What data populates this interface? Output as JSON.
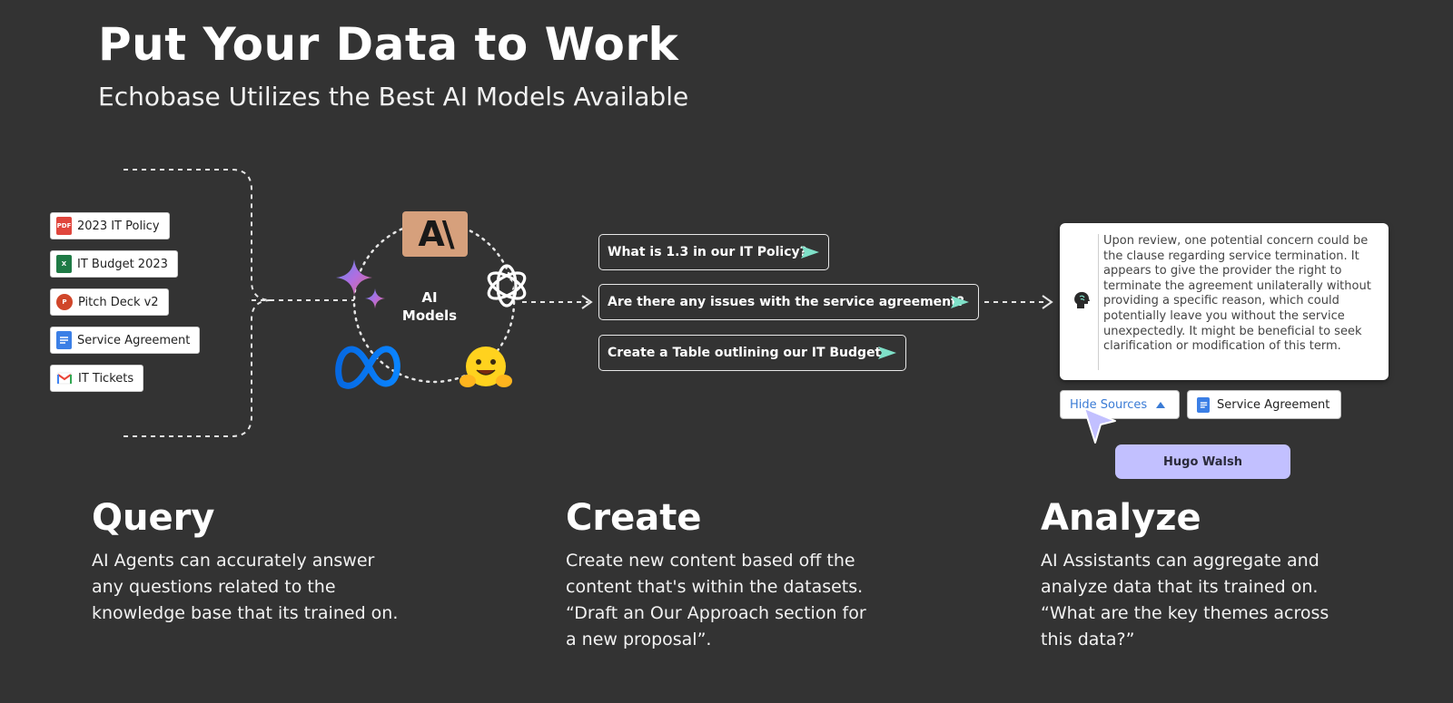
{
  "header": {
    "title": "Put Your Data to Work",
    "subtitle": "Echobase Utilizes the Best AI Models Available"
  },
  "files": [
    {
      "label": "2023 IT Policy",
      "icon": "pdf-icon",
      "icon_text": "PDF",
      "color": "#e0463d"
    },
    {
      "label": "IT Budget 2023",
      "icon": "excel-icon",
      "icon_text": "X",
      "color": "#1e7a45"
    },
    {
      "label": "Pitch Deck v2",
      "icon": "powerpoint-icon",
      "icon_text": "P",
      "color": "#d0462a"
    },
    {
      "label": "Service Agreement",
      "icon": "docs-icon",
      "icon_text": "",
      "color": "#3b7fe6"
    },
    {
      "label": "IT Tickets",
      "icon": "gmail-icon",
      "icon_text": "M",
      "color": "#ea4335"
    }
  ],
  "models": {
    "label_line1": "AI",
    "label_line2": "Models",
    "anthropic_text": "A\\",
    "icons": [
      "anthropic-icon",
      "openai-icon",
      "gemini-icon",
      "meta-icon",
      "huggingface-icon"
    ]
  },
  "queries": [
    {
      "label": "What is 1.3 in our IT Policy?"
    },
    {
      "label": "Are there any issues with the service agreement?"
    },
    {
      "label": "Create a Table outlining our IT Budget"
    }
  ],
  "answer": {
    "text": "Upon review, one potential concern could be the clause regarding service termination. It appears to give the provider the right to terminate the agreement unilaterally without providing a specific reason, which could potentially leave you without the service unexpectedly. It might be beneficial to seek clarification or modification of this term."
  },
  "sources": {
    "toggle_label": "Hide Sources",
    "doc_label": "Service Agreement"
  },
  "cursor_user": "Hugo Walsh",
  "columns": [
    {
      "heading": "Query",
      "body": "AI Agents can accurately answer any questions related to the knowledge base that its trained on."
    },
    {
      "heading": "Create",
      "body": "Create new content based off the content that's within the datasets. “Draft an Our Approach section for a new proposal”."
    },
    {
      "heading": "Analyze",
      "body": "AI Assistants can aggregate and analyze data that its trained on. “What are the key themes across this data?”"
    }
  ],
  "colors": {
    "background": "#333333",
    "send_accent": "#7fe0c8",
    "cursor_accent": "#c2c0ff",
    "link_blue": "#3a7bd5"
  }
}
